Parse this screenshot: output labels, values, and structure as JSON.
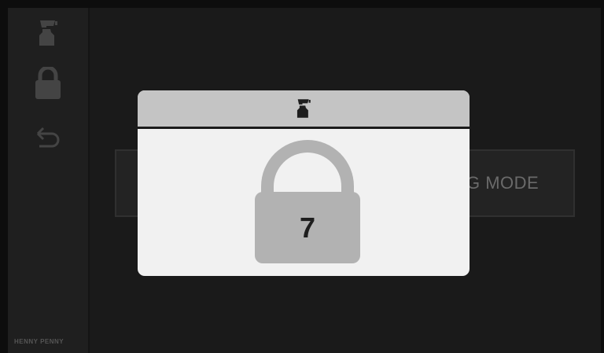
{
  "brand": "HENNY PENNY",
  "sidebar": {
    "items": [
      {
        "icon": "spray-bottle-icon"
      },
      {
        "icon": "lock-icon"
      },
      {
        "icon": "back-arrow-icon"
      }
    ]
  },
  "main": {
    "mode_button_label": "G MODE"
  },
  "dialog": {
    "header_icon": "spray-bottle-icon",
    "lock_icon": "lock-icon",
    "lock_code": "7"
  }
}
